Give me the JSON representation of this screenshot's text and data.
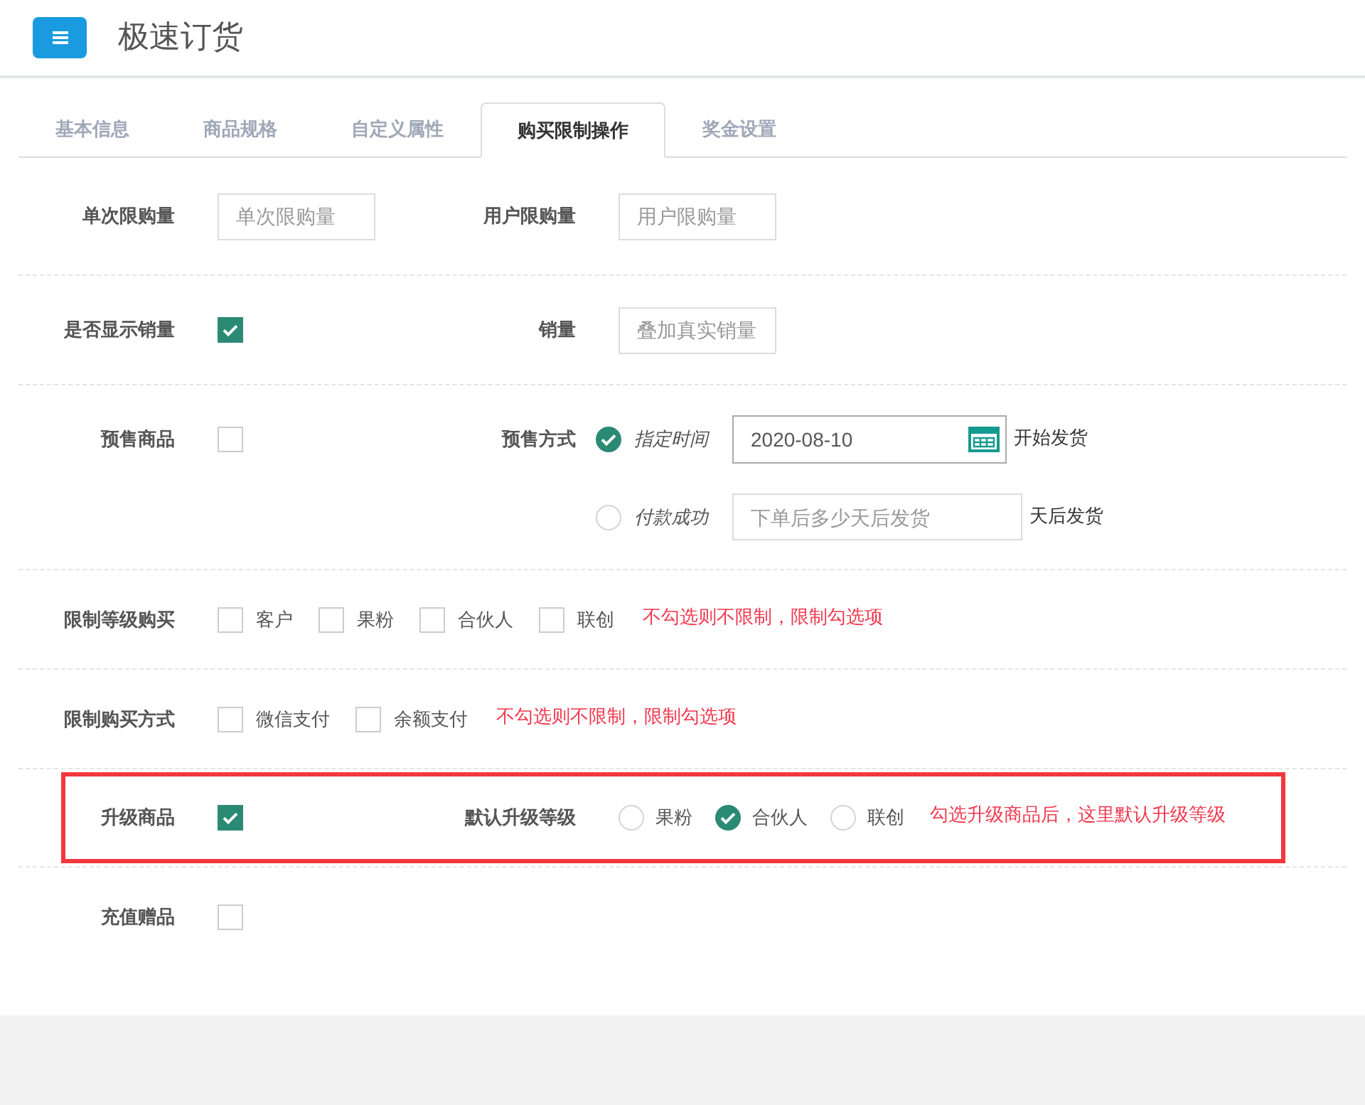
{
  "header": {
    "title": "极速订货"
  },
  "tabs": [
    {
      "label": "基本信息",
      "selected": false
    },
    {
      "label": "商品规格",
      "selected": false
    },
    {
      "label": "自定义属性",
      "selected": false
    },
    {
      "label": "购买限制操作",
      "selected": true
    },
    {
      "label": "奖金设置",
      "selected": false
    }
  ],
  "rows": [
    {
      "highlighted": false,
      "fields": [
        {
          "label": "单次限购量",
          "kind": "input",
          "placeholder": "单次限购量"
        },
        {
          "label": "用户限购量",
          "kind": "input",
          "placeholder": "用户限购量"
        }
      ]
    },
    {
      "highlighted": false,
      "fields": [
        {
          "label": "是否显示销量",
          "kind": "checkbox",
          "checked": true
        },
        {
          "label": "销量",
          "kind": "input",
          "placeholder": "叠加真实销量"
        }
      ]
    },
    {
      "highlighted": false,
      "fields": [
        {
          "label": "预售商品",
          "kind": "checkbox",
          "checked": false
        },
        {
          "label": "预售方式",
          "kind": "presale",
          "options": [
            {
              "label": "指定时间",
              "selected": true,
              "value": "2020-08-10",
              "suffix": "开始发货"
            },
            {
              "label": "付款成功",
              "selected": false,
              "placeholder": "下单后多少天后发货",
              "suffix": "天后发货"
            }
          ]
        }
      ]
    },
    {
      "highlighted": false,
      "fields": [
        {
          "label": "限制等级购买",
          "kind": "checklist",
          "options": [
            {
              "label": "客户",
              "checked": false
            },
            {
              "label": "果粉",
              "checked": false
            },
            {
              "label": "合伙人",
              "checked": false
            },
            {
              "label": "联创",
              "checked": false
            }
          ],
          "hint": "不勾选则不限制，限制勾选项"
        }
      ]
    },
    {
      "highlighted": false,
      "fields": [
        {
          "label": "限制购买方式",
          "kind": "checklist",
          "options": [
            {
              "label": "微信支付",
              "checked": false
            },
            {
              "label": "余额支付",
              "checked": false
            }
          ],
          "hint": "不勾选则不限制，限制勾选项"
        }
      ]
    },
    {
      "highlighted": true,
      "fields": [
        {
          "label": "升级商品",
          "kind": "checkbox",
          "checked": true
        },
        {
          "label": "默认升级等级",
          "kind": "radios",
          "options": [
            {
              "label": "果粉",
              "selected": false
            },
            {
              "label": "合伙人",
              "selected": true
            },
            {
              "label": "联创",
              "selected": false
            }
          ],
          "hint": "勾选升级商品后，这里默认升级等级"
        }
      ]
    },
    {
      "highlighted": false,
      "fields": [
        {
          "label": "充值赠品",
          "kind": "checkbox",
          "checked": false
        }
      ]
    }
  ]
}
